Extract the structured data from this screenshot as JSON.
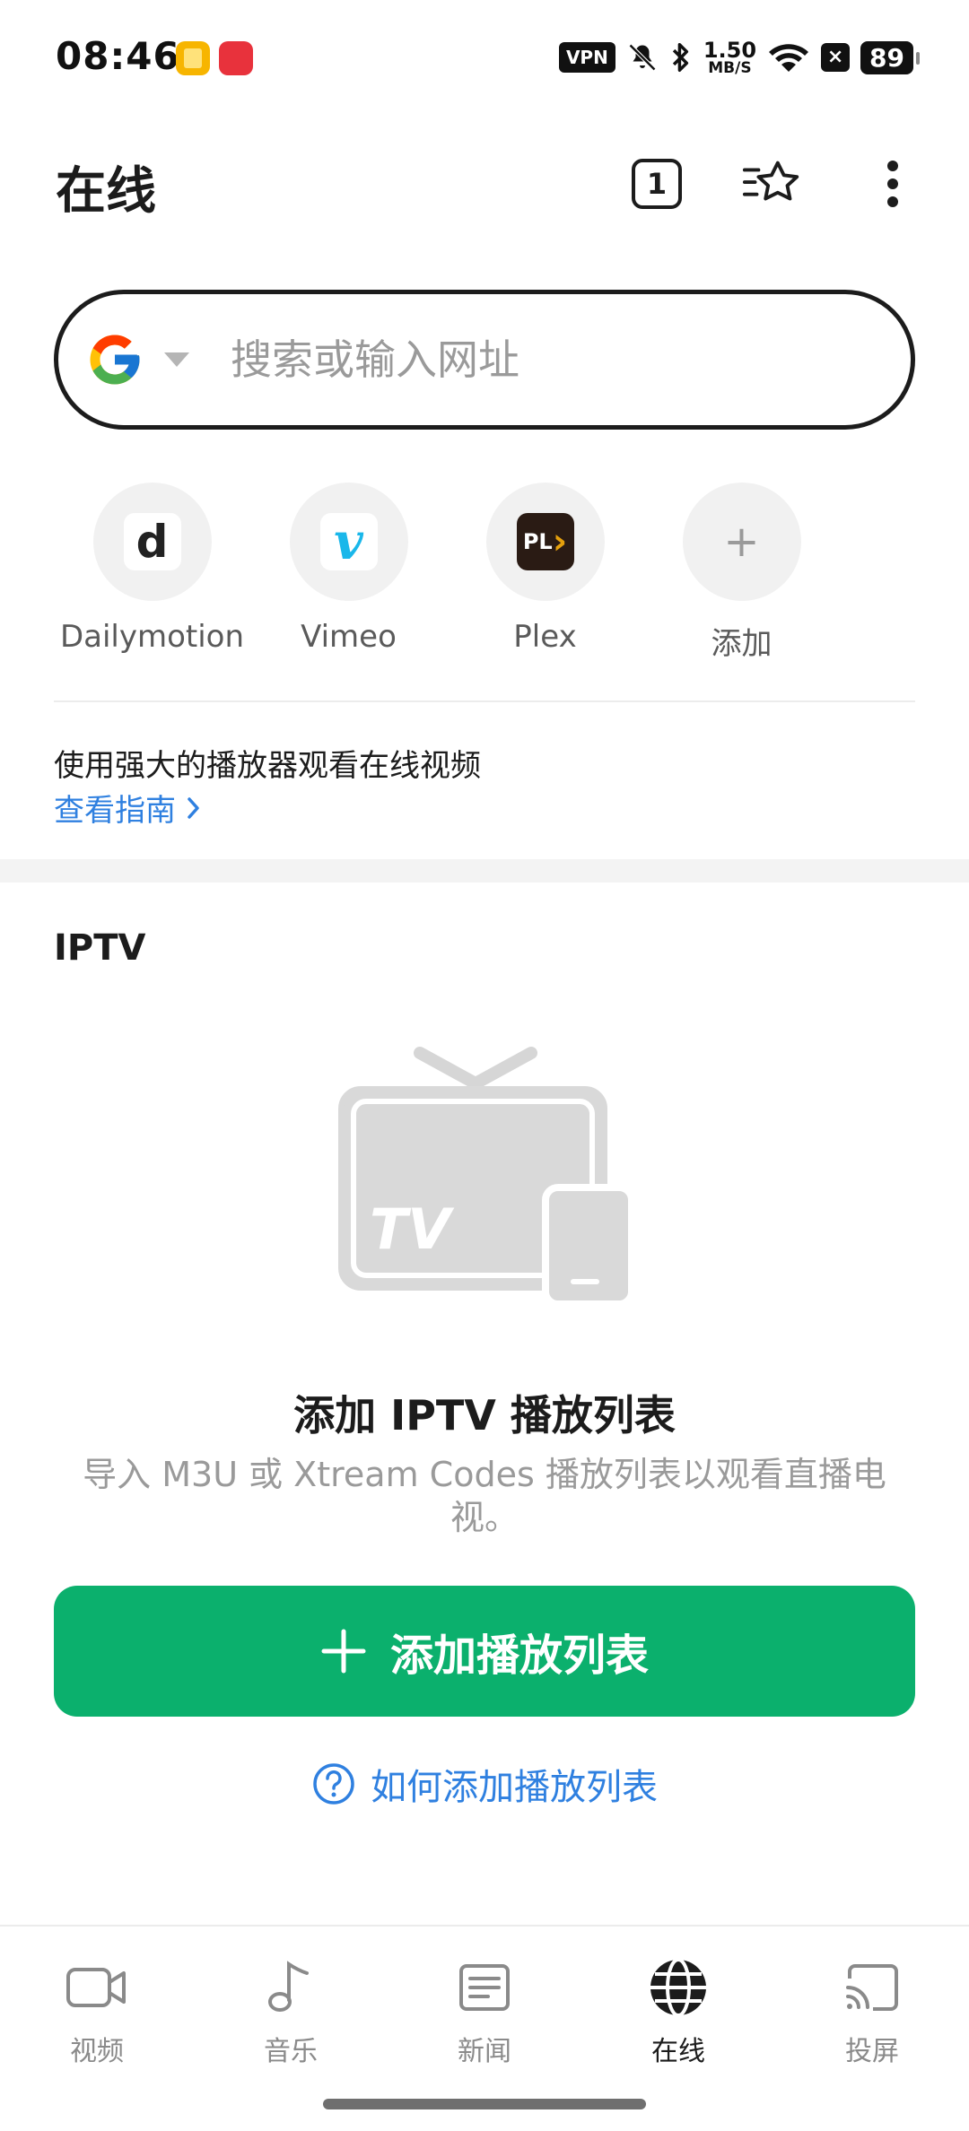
{
  "status_bar": {
    "time": "08:46",
    "app2_badge": "小红书",
    "vpn": "VPN",
    "net_speed_value": "1.50",
    "net_speed_unit": "MB/S",
    "battery": "89"
  },
  "header": {
    "title": "在线",
    "tabs_count": "1"
  },
  "search": {
    "engine": "google",
    "placeholder": "搜索或输入网址",
    "value": ""
  },
  "shortcuts": [
    {
      "label": "Dailymotion",
      "logo_text": "d"
    },
    {
      "label": "Vimeo",
      "logo_text": "v"
    },
    {
      "label": "Plex",
      "logo_text": "PL"
    },
    {
      "label": "添加",
      "logo_text": "+"
    }
  ],
  "promo": {
    "text": "使用强大的播放器观看在线视频",
    "link": "查看指南"
  },
  "iptv": {
    "section_title": "IPTV",
    "tv_label": "TV",
    "empty_title": "添加 IPTV 播放列表",
    "empty_desc": "导入 M3U 或 Xtream Codes 播放列表以观看直播电视。",
    "add_button": "添加播放列表",
    "help_link": "如何添加播放列表"
  },
  "colors": {
    "accent_green": "#0bb06d",
    "link_blue": "#2f80e0"
  },
  "bottom_nav": [
    {
      "label": "视频",
      "icon": "video-icon",
      "active": false
    },
    {
      "label": "音乐",
      "icon": "music-icon",
      "active": false
    },
    {
      "label": "新闻",
      "icon": "news-icon",
      "active": false
    },
    {
      "label": "在线",
      "icon": "globe-icon",
      "active": true
    },
    {
      "label": "投屏",
      "icon": "cast-icon",
      "active": false
    }
  ]
}
